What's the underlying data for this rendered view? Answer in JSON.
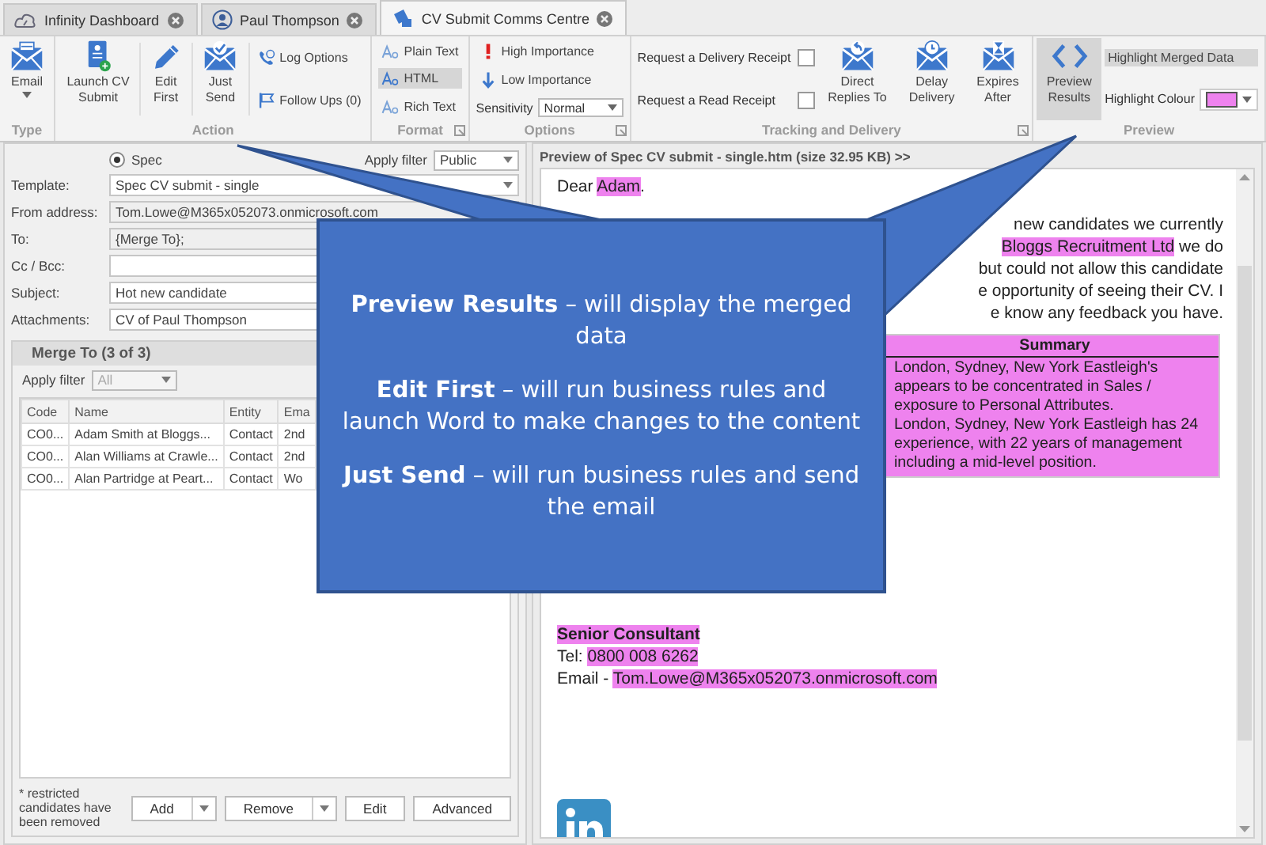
{
  "tabs": [
    {
      "label": "Infinity Dashboard",
      "selected": false
    },
    {
      "label": "Paul Thompson",
      "selected": false
    },
    {
      "label": "CV Submit Comms Centre",
      "selected": true
    }
  ],
  "ribbon": {
    "groups": [
      {
        "label": "Type",
        "launcher": false,
        "items": [
          {
            "kind": "large",
            "label": "Email",
            "dropdown": true,
            "selected": false
          }
        ]
      },
      {
        "label": "Action",
        "launcher": false,
        "items": [
          {
            "kind": "large",
            "label": "Launch CV Submit",
            "dropdown": false,
            "selected": false
          },
          {
            "kind": "large",
            "label": "Edit First",
            "dropdown": false,
            "selected": false
          },
          {
            "kind": "large",
            "label": "Just Send",
            "dropdown": false,
            "selected": false
          },
          {
            "kind": "stack",
            "rows": [
              {
                "kind": "button",
                "label": "Log Options",
                "selected": false
              },
              {
                "kind": "button",
                "label": "Follow Ups (0)",
                "selected": false
              }
            ]
          }
        ]
      },
      {
        "label": "Format",
        "launcher": true,
        "items": [
          {
            "kind": "stack",
            "rows": [
              {
                "kind": "button",
                "label": "Plain Text",
                "selected": false
              },
              {
                "kind": "button",
                "label": "HTML",
                "selected": true
              },
              {
                "kind": "button",
                "label": "Rich Text",
                "selected": false
              }
            ]
          }
        ]
      },
      {
        "label": "Options",
        "launcher": true,
        "items": [
          {
            "kind": "stack",
            "rows": [
              {
                "kind": "button",
                "label": "High Importance",
                "selected": false
              },
              {
                "kind": "button",
                "label": "Low Importance",
                "selected": false
              },
              {
                "kind": "select",
                "label": "Sensitivity",
                "value": "Normal"
              }
            ]
          }
        ]
      },
      {
        "label": "Tracking and Delivery",
        "launcher": true,
        "items": [
          {
            "kind": "stack",
            "rows": [
              {
                "kind": "check",
                "label": "Request a Delivery Receipt",
                "checked": false
              },
              {
                "kind": "check",
                "label": "Request a Read Receipt",
                "checked": false
              }
            ]
          },
          {
            "kind": "large",
            "label": "Direct Replies To",
            "dropdown": false,
            "selected": false
          },
          {
            "kind": "large",
            "label": "Delay Delivery",
            "dropdown": false,
            "selected": false
          },
          {
            "kind": "large",
            "label": "Expires After",
            "dropdown": false,
            "selected": false
          }
        ]
      },
      {
        "label": "Preview",
        "launcher": false,
        "items": [
          {
            "kind": "large",
            "label": "Preview Results",
            "dropdown": false,
            "selected": true
          },
          {
            "kind": "stack",
            "rows": [
              {
                "kind": "button",
                "label": "Highlight Merged Data",
                "selected": true
              },
              {
                "kind": "color",
                "label": "Highlight Colour",
                "color": "#ee82ee"
              }
            ]
          }
        ]
      }
    ]
  },
  "compose": {
    "spec": {
      "label": "Spec",
      "selected": true
    },
    "apply_filter": {
      "label": "Apply filter",
      "value": "Public"
    },
    "fields": [
      {
        "kind": "select",
        "label": "Template:",
        "value": "Spec CV submit - single"
      },
      {
        "kind": "readonly",
        "label": "From address:",
        "value": "Tom.Lowe@M365x052073.onmicrosoft.com"
      },
      {
        "kind": "readonly",
        "label": "To:",
        "value": "{Merge To};"
      },
      {
        "kind": "text",
        "label": "Cc / Bcc:"
      },
      {
        "kind": "text",
        "label": "Subject:",
        "value": "Hot new candidate"
      },
      {
        "kind": "text",
        "label": "Attachments:",
        "value": "CV of Paul Thompson"
      }
    ]
  },
  "merge_to": {
    "title": "Merge To (3 of 3)",
    "apply_filter": {
      "label": "Apply filter",
      "value": "All",
      "disabled": true
    },
    "table": {
      "columns": [
        "Code",
        "Name",
        "Entity",
        "Ema"
      ],
      "rows": [
        [
          "CO0...",
          "Adam Smith at Bloggs...",
          "Contact",
          "2nd"
        ],
        [
          "CO0...",
          "Alan Williams at Crawle...",
          "Contact",
          "2nd"
        ],
        [
          "CO0...",
          "Alan Partridge at Peart...",
          "Contact",
          "Wo"
        ]
      ]
    },
    "note": "* restricted candidates have been removed",
    "buttons": [
      {
        "label": "Add",
        "dropdown": true
      },
      {
        "label": "Remove",
        "dropdown": true
      },
      {
        "label": "Edit",
        "dropdown": false
      },
      {
        "label": "Advanced",
        "dropdown": false
      }
    ]
  },
  "preview": {
    "title": "Preview of Spec CV submit - single.htm (size 32.95 KB) >>",
    "greeting": [
      {
        "text": "Dear ",
        "merged": false
      },
      {
        "text": "Adam",
        "merged": true
      },
      {
        "text": ".",
        "merged": false
      }
    ],
    "letter_lines": [
      [
        {
          "text": "new candidates we currently",
          "merged": false
        }
      ],
      [
        {
          "text": "Bloggs Recruitment Ltd",
          "merged": true
        },
        {
          "text": " we do",
          "merged": false
        }
      ],
      [
        {
          "text": "but could not allow this candidate",
          "merged": false
        }
      ],
      [
        {
          "text": "e opportunity of seeing their CV.  I",
          "merged": false
        }
      ],
      [
        {
          "text": "e know any feedback you have.",
          "merged": false
        }
      ]
    ],
    "summary": {
      "heading": "Summary",
      "lines": [
        "London, Sydney, New York Eastleigh's",
        "appears to be concentrated in Sales /",
        "exposure to Personal Attributes.",
        "London, Sydney, New York Eastleigh has 24",
        "experience, with 22 years of management",
        "including a mid-level position."
      ]
    },
    "signature": [
      {
        "bold": true,
        "segments": [
          {
            "text": "Senior Consultant",
            "merged": true
          }
        ]
      },
      {
        "bold": false,
        "segments": [
          {
            "text": "Tel: ",
            "merged": false
          },
          {
            "text": "0800 008 6262",
            "merged": true
          }
        ]
      },
      {
        "bold": false,
        "segments": [
          {
            "text": "Email - ",
            "merged": false
          },
          {
            "text": "Tom.Lowe@M365x052073.onmicrosoft.com",
            "merged": true
          }
        ]
      }
    ]
  },
  "callout": {
    "paragraphs": [
      "**Preview Results** – will display the merged data",
      "**Edit First** – will run business rules and launch Word to make changes to the content",
      "**Just Send** – will run business rules and send the email"
    ]
  }
}
